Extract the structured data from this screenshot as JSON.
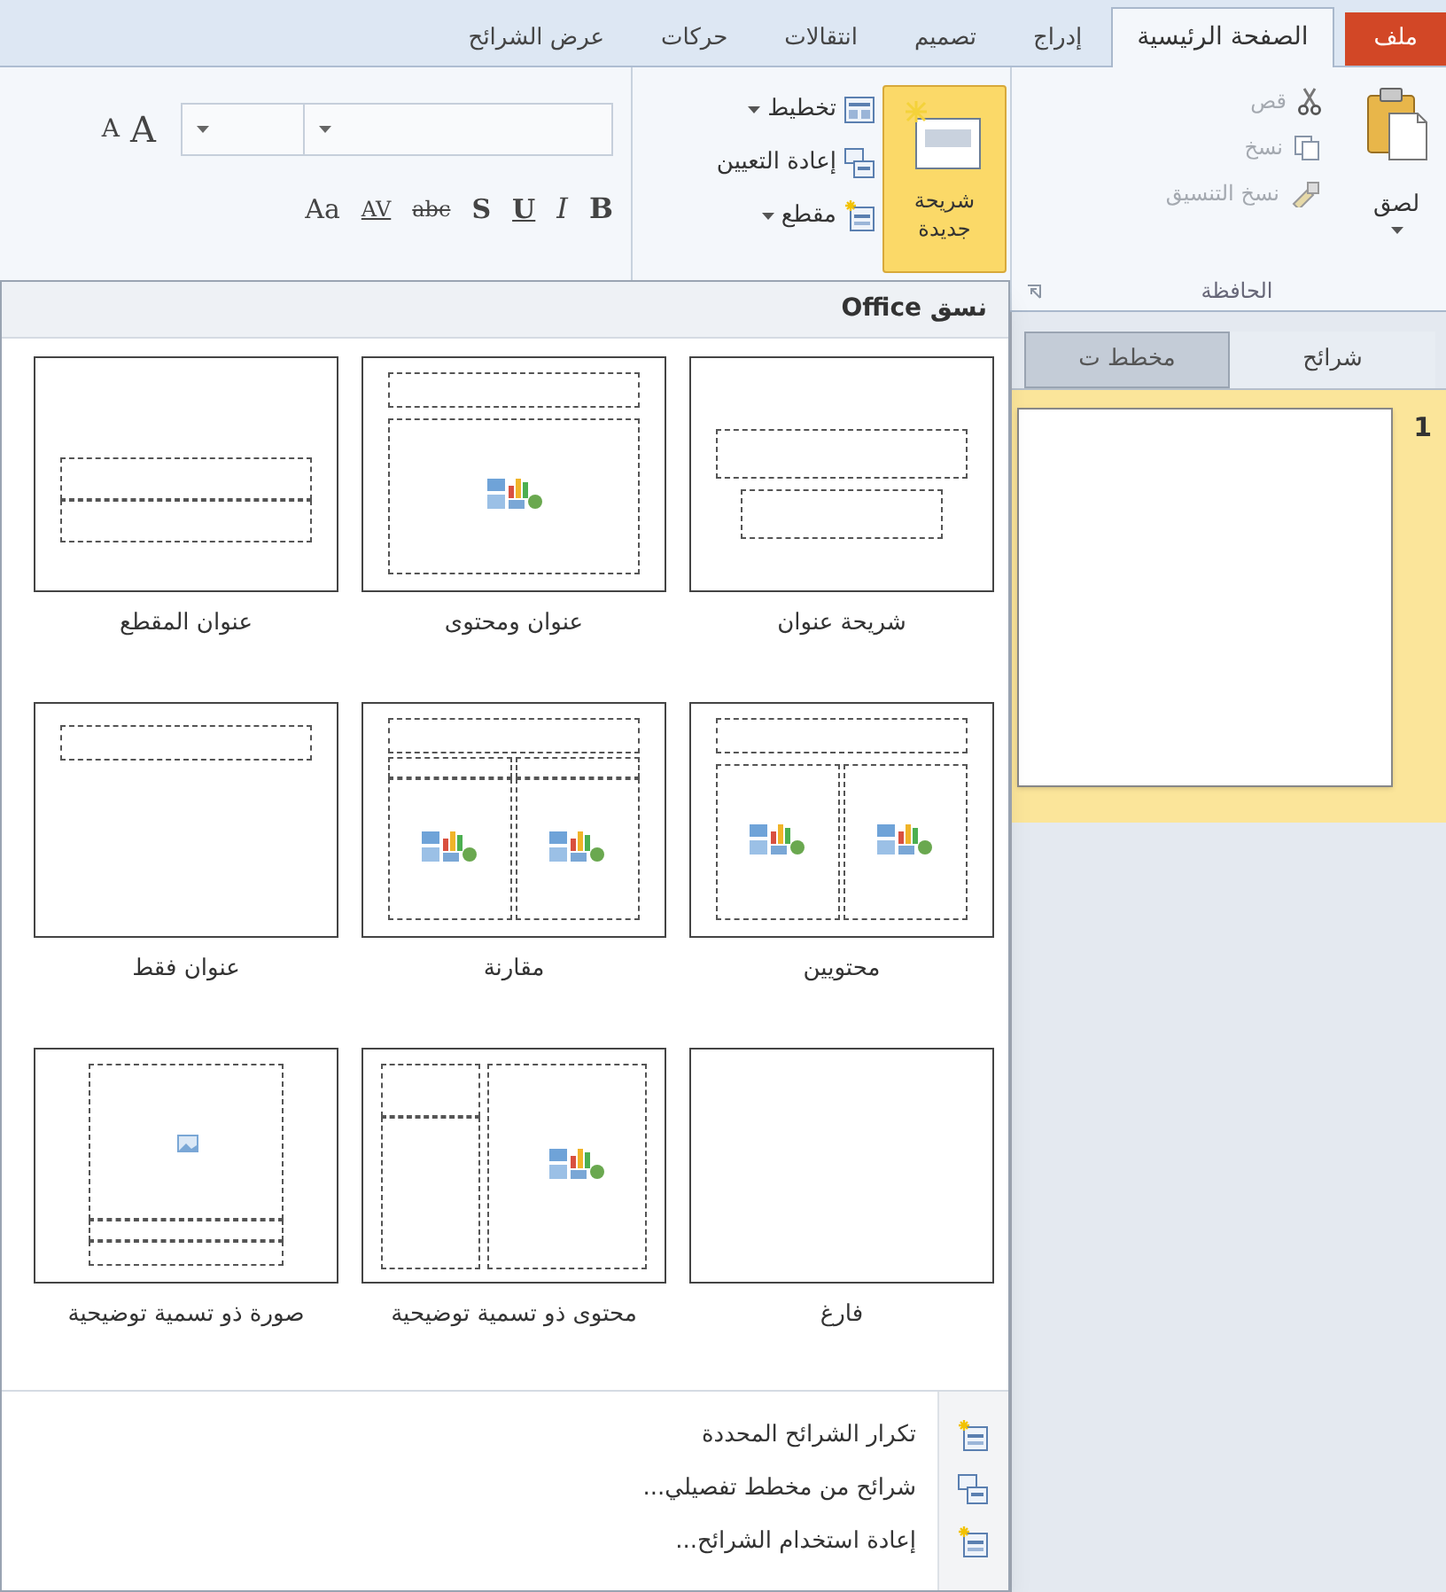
{
  "tabs": [
    {
      "label": "ملف",
      "kind": "file",
      "selected": false
    },
    {
      "label": "الصفحة الرئيسية",
      "kind": "tab",
      "selected": true
    },
    {
      "label": "إدراج",
      "kind": "tab",
      "selected": false
    },
    {
      "label": "تصميم",
      "kind": "tab",
      "selected": false
    },
    {
      "label": "انتقالات",
      "kind": "tab",
      "selected": false
    },
    {
      "label": "حركات",
      "kind": "tab",
      "selected": false
    },
    {
      "label": "عرض الشرائح",
      "kind": "tab",
      "selected": false
    }
  ],
  "clipboard": {
    "label": "الحافظة",
    "paste": "لصق",
    "items": [
      {
        "kind": "cut",
        "label": "قص",
        "disabled": true
      },
      {
        "kind": "copy",
        "label": "نسخ",
        "disabled": true
      },
      {
        "kind": "painter",
        "label": "نسخ التنسيق",
        "disabled": true
      }
    ]
  },
  "slides_group": {
    "new_slide": {
      "lines": [
        "شريحة",
        "جديدة"
      ],
      "pressed": true
    },
    "items": [
      {
        "kind": "layout",
        "label": "تخطيط",
        "dropdown": true
      },
      {
        "kind": "reset",
        "label": "إعادة التعيين",
        "dropdown": false
      },
      {
        "kind": "section",
        "label": "مقطع",
        "dropdown": true
      }
    ]
  },
  "font_group": {
    "grow": "A",
    "shrink": "A",
    "buttons": [
      {
        "label": "B",
        "kind": "bold"
      },
      {
        "label": "I",
        "kind": "italic"
      },
      {
        "label": "U",
        "kind": "underline"
      },
      {
        "label": "S",
        "kind": "shadow"
      },
      {
        "label": "abc",
        "kind": "strike"
      },
      {
        "label": "AV",
        "kind": "spacing"
      },
      {
        "label": "Aa",
        "kind": "case"
      }
    ]
  },
  "panel": {
    "tabs": [
      {
        "label": "شرائح",
        "selected": true
      },
      {
        "label": "مخطط ت",
        "selected": false
      }
    ],
    "slides": [
      {
        "number": "1",
        "selected": true
      }
    ]
  },
  "dropdown": {
    "header": "نسق Office",
    "layouts": [
      {
        "kind": "title",
        "label": "شريحة عنوان"
      },
      {
        "kind": "title_content",
        "label": "عنوان ومحتوى"
      },
      {
        "kind": "section",
        "label": "عنوان المقطع"
      },
      {
        "kind": "two_content",
        "label": "محتويين"
      },
      {
        "kind": "comparison",
        "label": "مقارنة"
      },
      {
        "kind": "title_only",
        "label": "عنوان فقط"
      },
      {
        "kind": "blank",
        "label": "فارغ"
      },
      {
        "kind": "content_caption",
        "label": "محتوى ذو تسمية توضيحية"
      },
      {
        "kind": "picture_caption",
        "label": "صورة ذو تسمية توضيحية"
      }
    ],
    "menu": [
      {
        "kind": "duplicate",
        "label": "تكرار الشرائح المحددة"
      },
      {
        "kind": "outline",
        "label": "شرائح من مخطط تفصيلي..."
      },
      {
        "kind": "reuse",
        "label": "إعادة استخدام الشرائح..."
      }
    ]
  }
}
